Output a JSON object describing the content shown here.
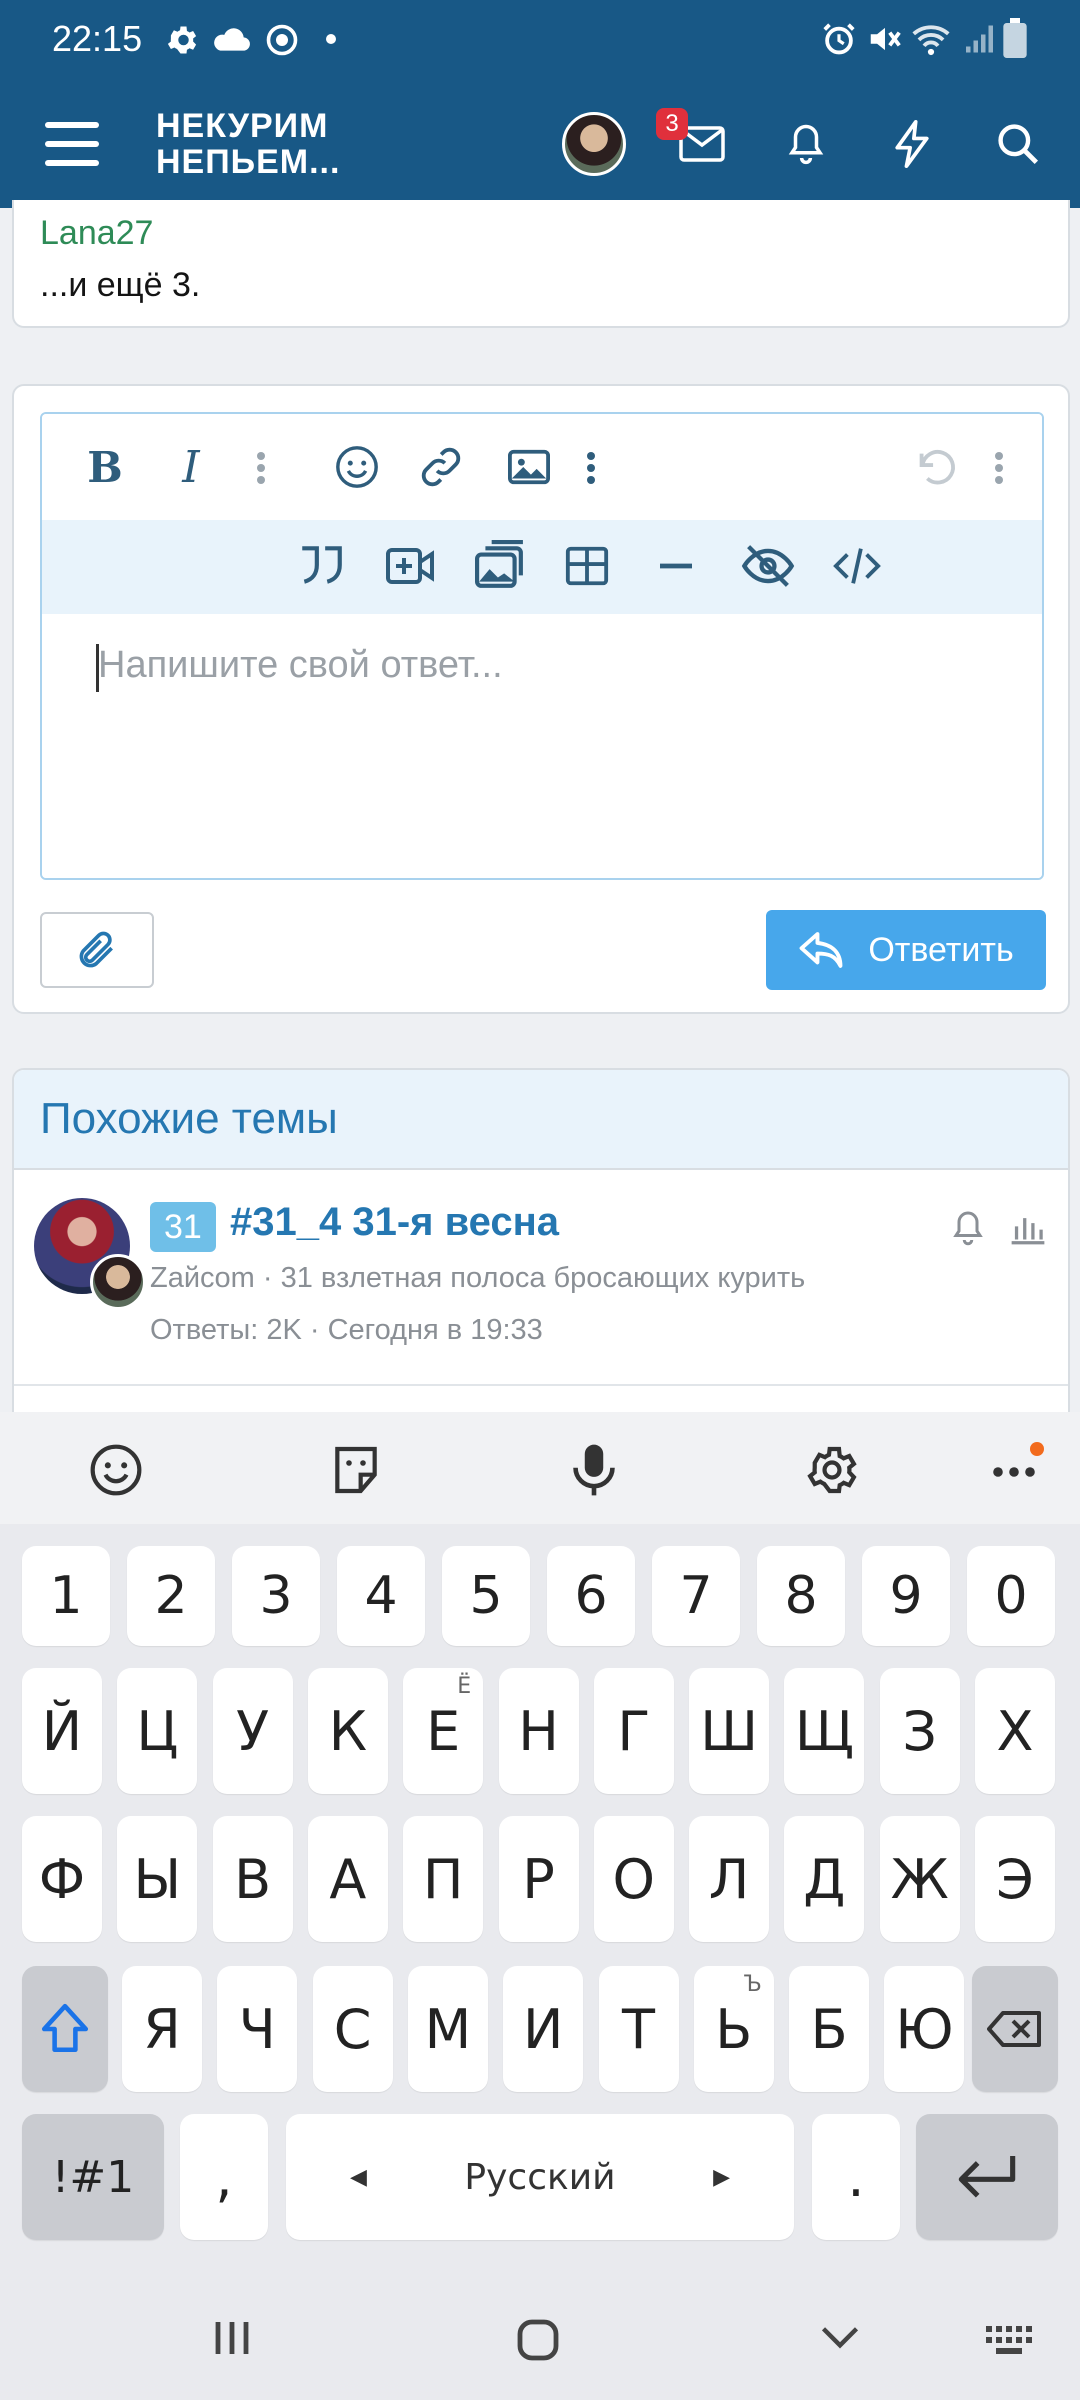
{
  "status_bar": {
    "time": "22:15"
  },
  "header": {
    "logo_line1": "НЕКУРИМ",
    "logo_line2": "НЕПЬЕМ...",
    "messages_badge": "3"
  },
  "previous_post": {
    "username": "Lana27",
    "more_text": "...и ещё 3."
  },
  "editor": {
    "placeholder": "Напишите свой ответ...",
    "reply_button_label": "Ответить"
  },
  "similar": {
    "heading": "Похожие темы",
    "thread": {
      "tag": "31",
      "title": "#31_4 31-я весна",
      "author": "Zaйcom",
      "forum": "31 взлетная полоса бросающих курить",
      "meta": "Ответы: 2K · Сегодня в 19:33"
    }
  },
  "keyboard": {
    "number_row": [
      "1",
      "2",
      "3",
      "4",
      "5",
      "6",
      "7",
      "8",
      "9",
      "0"
    ],
    "row1": [
      "Й",
      "Ц",
      "У",
      "К",
      "Е",
      "Н",
      "Г",
      "Ш",
      "Щ",
      "З",
      "Х"
    ],
    "row1_hint": "Ё",
    "row2": [
      "Ф",
      "Ы",
      "В",
      "А",
      "П",
      "Р",
      "О",
      "Л",
      "Д",
      "Ж",
      "Э"
    ],
    "row3": [
      "Я",
      "Ч",
      "С",
      "М",
      "И",
      "Т",
      "Ь",
      "Б",
      "Ю"
    ],
    "row3_hint": "Ъ",
    "symbols_label": "!#1",
    "comma": ",",
    "space_label": "Русский",
    "period": "."
  },
  "colors": {
    "header_bg": "#185886",
    "link_blue": "#2577b1",
    "accent_blue": "#47a7eb",
    "username_green": "#2e8b57",
    "badge_red": "#e0303c"
  }
}
